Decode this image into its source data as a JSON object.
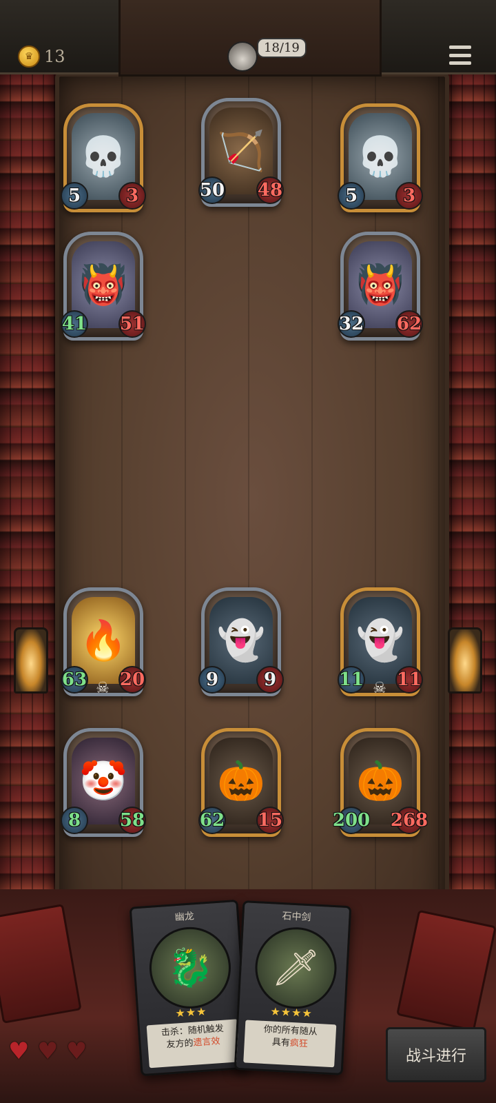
{
  "topbar": {
    "gold": "13",
    "turn": "18/19"
  },
  "board": {
    "enemy_cards": [
      {
        "id": "skeleton-1",
        "icon": "skull-icon",
        "art": "💀",
        "frame": "gold",
        "attack": "5",
        "health": "3",
        "attack_color": "white",
        "health_color": "red"
      },
      {
        "id": "archer",
        "icon": "archer-icon",
        "art": "🏹",
        "frame": "silver",
        "attack": "50",
        "health": "48",
        "attack_color": "white",
        "health_color": "red"
      },
      {
        "id": "skeleton-2",
        "icon": "skull-icon",
        "art": "💀",
        "frame": "gold",
        "attack": "5",
        "health": "3",
        "attack_color": "white",
        "health_color": "red"
      },
      {
        "id": "ogre-1",
        "icon": "ogre-icon",
        "art": "👹",
        "frame": "silver",
        "attack": "41",
        "health": "51",
        "attack_color": "green",
        "health_color": "red"
      },
      {
        "id": "ogre-2",
        "icon": "ogre-icon",
        "art": "👹",
        "frame": "silver",
        "attack": "32",
        "health": "62",
        "attack_color": "white",
        "health_color": "red"
      }
    ],
    "player_cards": [
      {
        "id": "flame-spirit",
        "icon": "flame-icon",
        "art": "🔥",
        "frame": "silver",
        "attack": "63",
        "health": "20",
        "attack_color": "green",
        "health_color": "red",
        "skull": true
      },
      {
        "id": "ghost",
        "icon": "ghost-icon",
        "art": "👻",
        "frame": "silver",
        "attack": "9",
        "health": "9",
        "attack_color": "white",
        "health_color": "white"
      },
      {
        "id": "green-ghost",
        "icon": "ghost-icon",
        "art": "👻",
        "frame": "gold",
        "attack": "11",
        "health": "11",
        "attack_color": "green",
        "health_color": "red",
        "skull": true
      },
      {
        "id": "jester",
        "icon": "jester-icon",
        "art": "🤡",
        "frame": "silver",
        "attack": "8",
        "health": "58",
        "attack_color": "green",
        "health_color": "green"
      },
      {
        "id": "scarecrow",
        "icon": "pumpkin-icon",
        "art": "🎃",
        "frame": "gold",
        "attack": "62",
        "health": "15",
        "attack_color": "green",
        "health_color": "red"
      },
      {
        "id": "pumpkin-mummy",
        "icon": "pumpkin-icon",
        "art": "🎃",
        "frame": "gold",
        "attack": "200",
        "health": "268",
        "attack_color": "green",
        "health_color": "red"
      }
    ]
  },
  "hand": [
    {
      "name": "幽龙",
      "art": "🐉",
      "stars": "★★★",
      "desc_prefix": "击杀：随机触发",
      "desc_line2_prefix": "友方的",
      "desc_highlight": "遗言",
      "desc_suffix": "效"
    },
    {
      "name": "石中剑",
      "art": "🗡",
      "stars": "★★★★",
      "desc_prefix": "你的所有随从",
      "desc_line2_prefix": "具有",
      "desc_highlight": "疯狂",
      "desc_suffix": ""
    }
  ],
  "lives": {
    "total": 3,
    "filled": 1
  },
  "battle_button": "战斗进行"
}
